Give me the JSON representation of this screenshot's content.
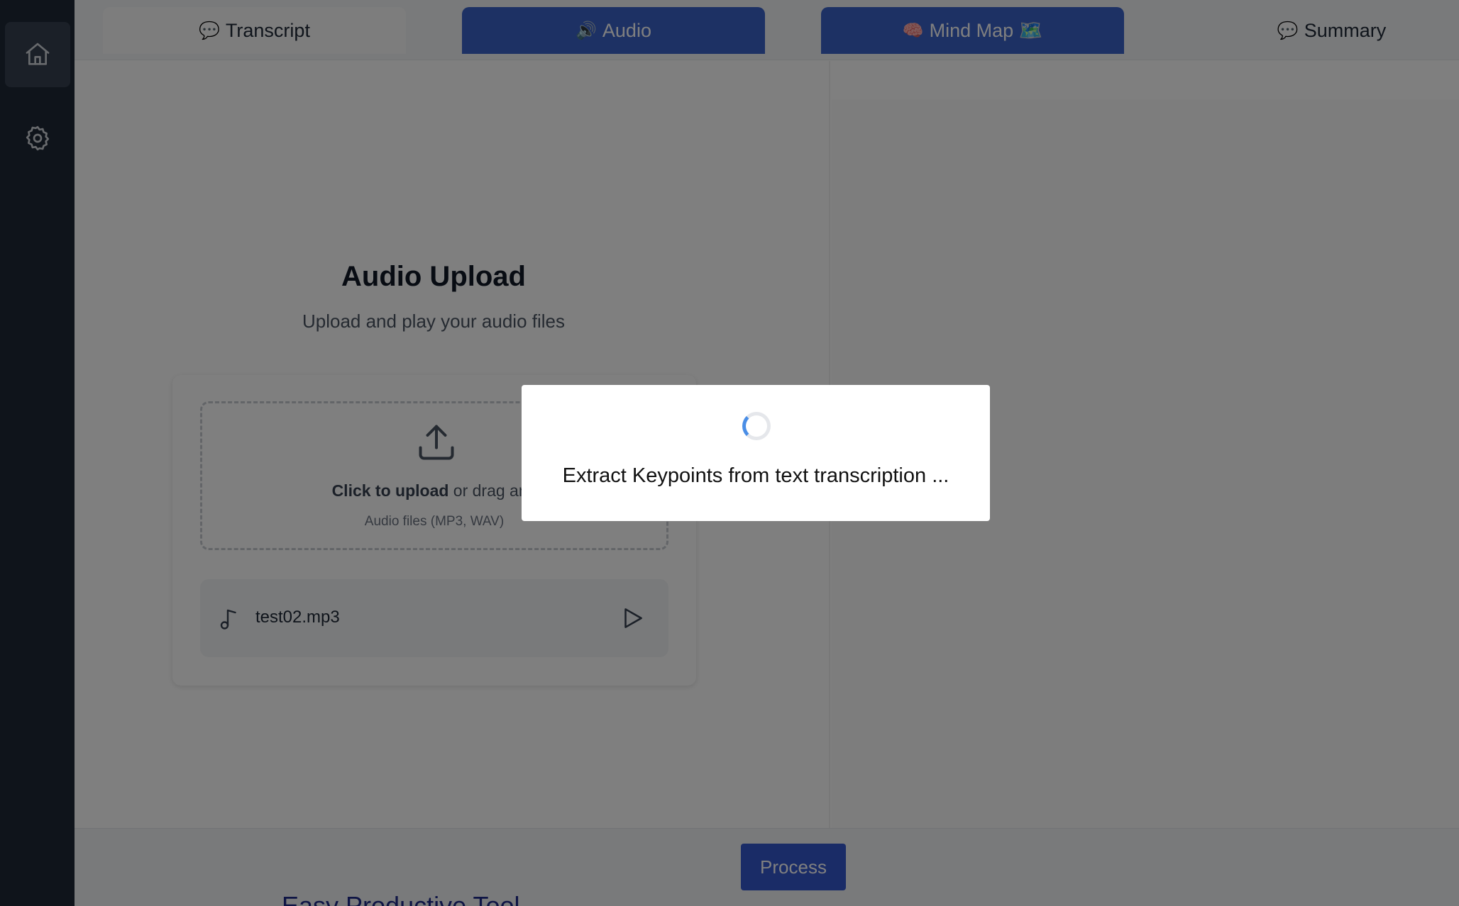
{
  "tabs": [
    {
      "emoji": "💬",
      "label": "Transcript"
    },
    {
      "emoji": "🔊",
      "label": "Audio"
    },
    {
      "emoji": "🧠",
      "label": "Mind Map 🗺️"
    },
    {
      "emoji": "💬",
      "label": "Summary"
    }
  ],
  "sidebar": {
    "items": [
      {
        "icon": "home-icon"
      },
      {
        "icon": "gear-icon"
      }
    ]
  },
  "main": {
    "title": "Audio Upload",
    "subtitle": "Upload and play your audio files",
    "dropzone": {
      "click_text": "Click to upload",
      "rest_text": " or drag and",
      "hint": "Audio files (MP3, WAV)"
    },
    "file": {
      "name": "test02.mp3"
    }
  },
  "footer": {
    "process_label": "Process",
    "peek_text": "Easy Productive Tool"
  },
  "modal": {
    "message": "Extract Keypoints from text transcription ..."
  },
  "colors": {
    "sidebar_bg": "#1f2937",
    "accent": "#3b63c9",
    "process": "#3558cf",
    "spinner": "#4a8ee6"
  }
}
